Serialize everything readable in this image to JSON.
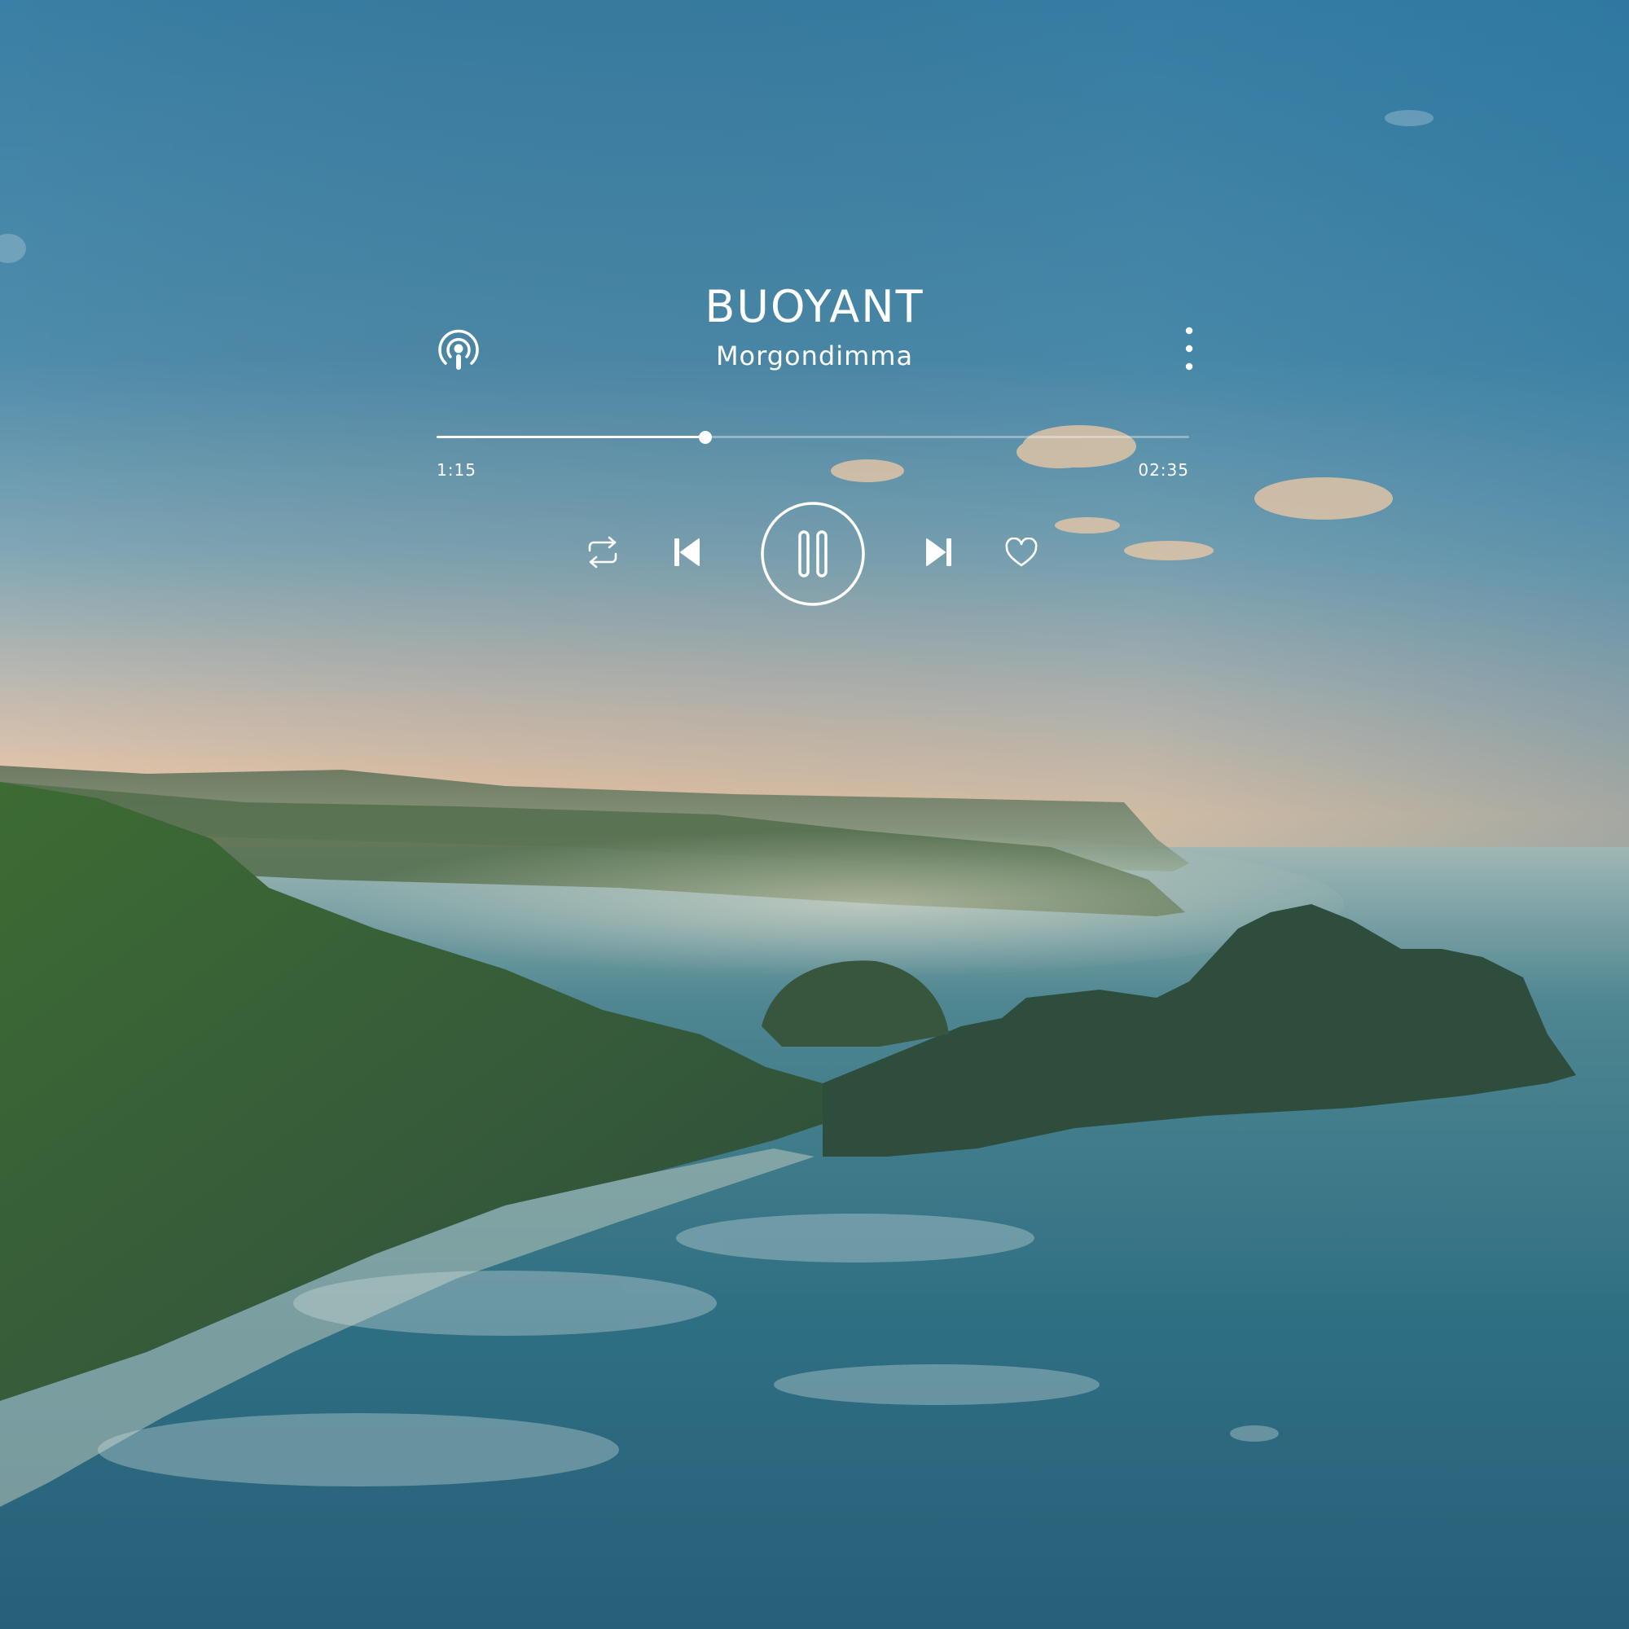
{
  "track": {
    "title": "BUOYANT",
    "artist": "Morgondimma",
    "elapsed": "1:15",
    "duration": "02:35",
    "progress": 0.357
  },
  "icons": {
    "source": "podcast-icon",
    "menu": "more-vertical-icon",
    "repeat": "repeat-icon",
    "previous": "skip-previous-icon",
    "play_state": "pause-icon",
    "next": "skip-next-icon",
    "favorite": "heart-icon"
  },
  "colors": {
    "foreground": "#ffffff",
    "sky_top": "#3f87a8",
    "sky_horizon": "#eec7a4",
    "hills": "#3f5f3a",
    "sea": "#2c6a7e"
  }
}
